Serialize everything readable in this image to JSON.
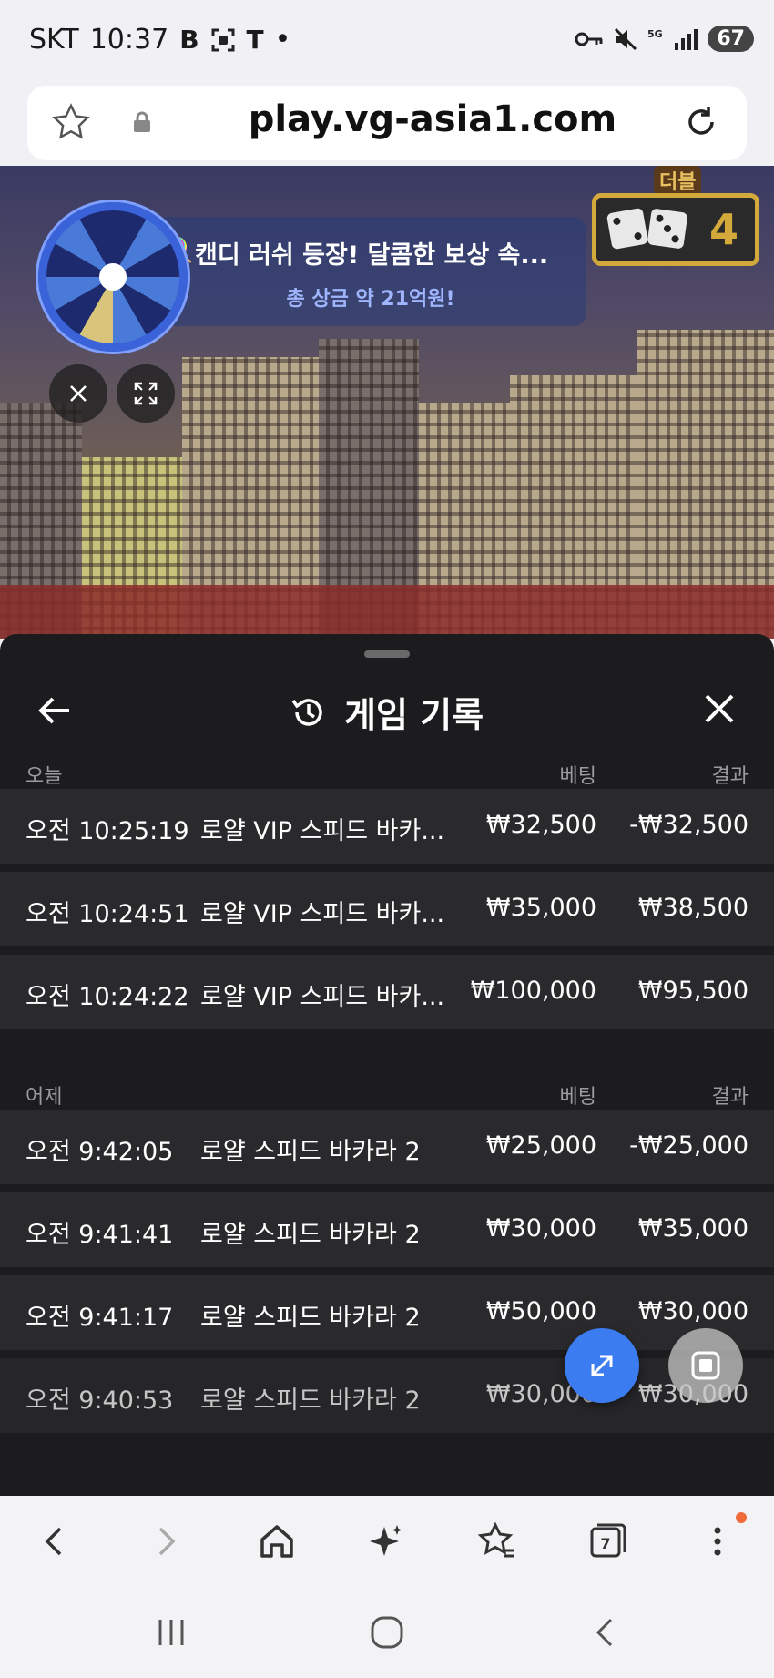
{
  "status_bar": {
    "carrier": "SKT",
    "time": "10:37",
    "icons": [
      "B",
      "scan-icon",
      "T",
      "•"
    ],
    "battery": "67"
  },
  "url_bar": {
    "domain": "play.vg-asia1.com"
  },
  "game": {
    "promo_title": "캔디 러쉬 등장! 달콤한 보상 속...",
    "promo_subtitle": "총 상금 약 21억원!",
    "dice_label": "더블",
    "dice_count": "4"
  },
  "sheet": {
    "title": "게임 기록",
    "sections": [
      {
        "label": "오늘",
        "bet_header": "베팅",
        "result_header": "결과",
        "rows": [
          {
            "time": "오전 10:25:19",
            "game": "로얄 VIP 스피드 바카...",
            "bet": "₩32,500",
            "result": "-₩32,500"
          },
          {
            "time": "오전 10:24:51",
            "game": "로얄 VIP 스피드 바카...",
            "bet": "₩35,000",
            "result": "₩38,500"
          },
          {
            "time": "오전 10:24:22",
            "game": "로얄 VIP 스피드 바카...",
            "bet": "₩100,000",
            "result": "₩95,500"
          }
        ]
      },
      {
        "label": "어제",
        "bet_header": "베팅",
        "result_header": "결과",
        "rows": [
          {
            "time": "오전 9:42:05",
            "game": "로얄 스피드 바카라 2",
            "bet": "₩25,000",
            "result": "-₩25,000"
          },
          {
            "time": "오전 9:41:41",
            "game": "로얄 스피드 바카라 2",
            "bet": "₩30,000",
            "result": "₩35,000"
          },
          {
            "time": "오전 9:41:17",
            "game": "로얄 스피드 바카라 2",
            "bet": "₩50,000",
            "result": "₩30,000"
          },
          {
            "time": "오전 9:40:53",
            "game": "로얄 스피드 바카라 2",
            "bet": "₩30,000",
            "result": "₩30,000"
          }
        ]
      }
    ]
  },
  "browser_nav": {
    "tabs_count": "7"
  },
  "colors": {
    "sheet_bg": "#1c1c1f",
    "row_bg": "#2a2a2d",
    "accent_blue": "#3b7cf0",
    "dice_gold": "#d4a93c"
  }
}
